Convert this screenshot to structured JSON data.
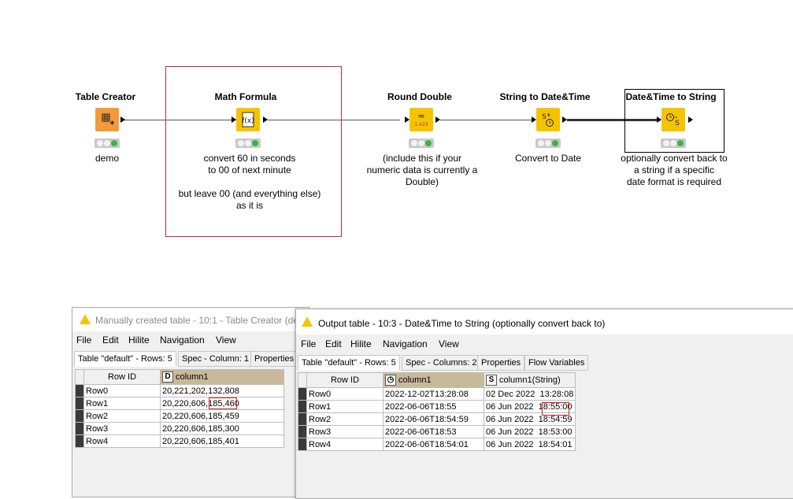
{
  "workflow": {
    "nodes": [
      {
        "title": "Table Creator",
        "label": "demo",
        "icon": "table-creator-icon"
      },
      {
        "title": "Math Formula",
        "label_lines": [
          "convert 60 in seconds",
          "to 00 of next minute",
          "",
          "but leave 00 (and everything else)",
          "as it is"
        ],
        "icon": "math-formula-icon"
      },
      {
        "title": "Round Double",
        "label_lines": [
          "(include this if your",
          "numeric data is currently a",
          "Double)"
        ],
        "icon": "round-double-icon",
        "icon_text": "1.423"
      },
      {
        "title": "String to Date&Time",
        "label": "Convert to Date",
        "icon": "string-to-datetime-icon"
      },
      {
        "title": "Date&Time to String",
        "label_lines": [
          "optionally convert back to",
          "a string if a specific",
          "date format is required"
        ],
        "icon": "datetime-to-string-icon"
      }
    ]
  },
  "window1": {
    "title": "Manually created table - 10:1 - Table Creator (de",
    "menu": [
      "File",
      "Edit",
      "Hilite",
      "Navigation",
      "View"
    ],
    "tabs": [
      "Table \"default\" - Rows: 5",
      "Spec - Column: 1",
      "Properties"
    ],
    "headers": {
      "rowid": "Row ID",
      "col1_type": "D",
      "col1": "column1"
    },
    "rows": [
      {
        "id": "Row0",
        "c1": "20,221,202,132,808"
      },
      {
        "id": "Row1",
        "c1": "20,220,606,185,460"
      },
      {
        "id": "Row2",
        "c1": "20,220,606,185,459"
      },
      {
        "id": "Row3",
        "c1": "20,220,606,185,300"
      },
      {
        "id": "Row4",
        "c1": "20,220,606,185,401"
      }
    ]
  },
  "window2": {
    "title": "Output table - 10:3 - Date&Time to String (optionally convert back to)",
    "menu": [
      "File",
      "Edit",
      "Hilite",
      "Navigation",
      "View"
    ],
    "tabs": [
      "Table \"default\" - Rows: 5",
      "Spec - Columns: 2",
      "Properties",
      "Flow Variables"
    ],
    "headers": {
      "rowid": "Row ID",
      "col1": "column1",
      "col2_type": "S",
      "col2": "column1(String)"
    },
    "rows": [
      {
        "id": "Row0",
        "c1": "2022-12-02T13:28:08",
        "c2": "02 Dec 2022  13:28:08"
      },
      {
        "id": "Row1",
        "c1": "2022-06-06T18:55",
        "c2": "06 Jun 2022  18:55:00"
      },
      {
        "id": "Row2",
        "c1": "2022-06-06T18:54:59",
        "c2": "06 Jun 2022  18:54:59"
      },
      {
        "id": "Row3",
        "c1": "2022-06-06T18:53",
        "c2": "06 Jun 2022  18:53:00"
      },
      {
        "id": "Row4",
        "c1": "2022-06-06T18:54:01",
        "c2": "06 Jun 2022  18:54:01"
      }
    ]
  },
  "colors": {
    "annotation_border": "#c8282c",
    "node_yellow": "#f5c400",
    "node_orange": "#f39a3a",
    "column_header": "#c8b99a",
    "highlight": "#d02020"
  }
}
